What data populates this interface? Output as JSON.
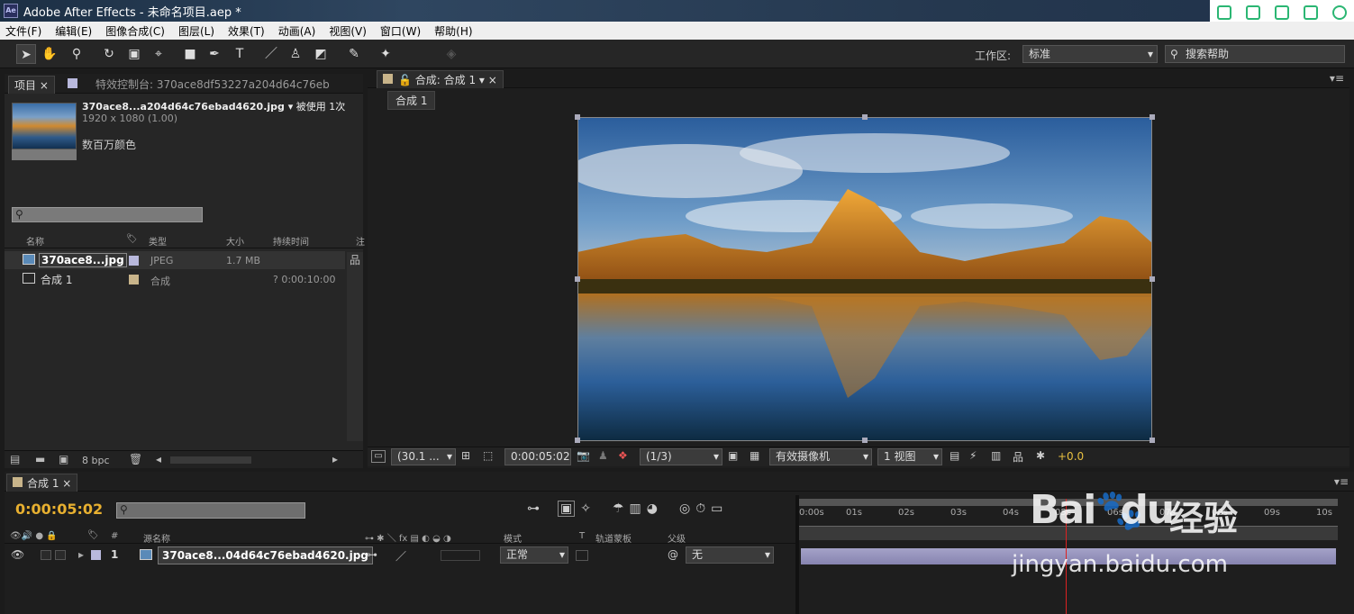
{
  "window": {
    "title": "Adobe After Effects - 未命名项目.aep *",
    "app_icon": "Ae"
  },
  "menu": [
    "文件(F)",
    "编辑(E)",
    "图像合成(C)",
    "图层(L)",
    "效果(T)",
    "动画(A)",
    "视图(V)",
    "窗口(W)",
    "帮助(H)"
  ],
  "toolbar": {
    "workspace_label": "工作区:",
    "workspace_value": "标准",
    "search_help": "搜索帮助"
  },
  "project_panel": {
    "tab_project": "项目",
    "tab_effects": "特效控制台: 370ace8df53227a204d64c76eb",
    "file_name": "370ace8...a204d64c76ebad4620.jpg",
    "usage": "▾ 被使用 1次",
    "dimensions": "1920 x 1080 (1.00)",
    "colors": "数百万颜色",
    "columns": [
      "名称",
      "类型",
      "大小",
      "持续时间",
      "注"
    ],
    "items": [
      {
        "name": "370ace8...jpg",
        "type": "JPEG",
        "size": "1.7 MB",
        "duration": "",
        "color": "#b8b8dc",
        "icon": "image-icon"
      },
      {
        "name": "合成 1",
        "type": "合成",
        "size": "",
        "duration": "? 0:00:10:00",
        "color": "#c8b48a",
        "icon": "composition-icon"
      }
    ],
    "bpc": "8 bpc"
  },
  "comp_panel": {
    "tab_label": "合成: 合成 1",
    "breadcrumb": "合成 1",
    "zoom": "(30.1 ...",
    "timecode": "0:00:05:02",
    "resolution": "(1/3)",
    "camera": "有效摄像机",
    "views": "1 视图",
    "exposure": "+0.0"
  },
  "timeline": {
    "tab_label": "合成 1",
    "timecode": "0:00:05:02",
    "col_headers": [
      "#",
      "源名称",
      "模式",
      "T",
      "轨道蒙板",
      "父级"
    ],
    "layer": {
      "index": "1",
      "name": "370ace8...04d64c76ebad4620.jpg",
      "mode": "正常",
      "parent": "无",
      "color": "#b8b8dc"
    },
    "ruler": [
      "0:00s",
      "01s",
      "02s",
      "03s",
      "04s",
      "05s",
      "06s",
      "07s",
      "08s",
      "09s",
      "10s"
    ],
    "current_time_fraction": 0.51
  },
  "watermark": {
    "brand": "Bai",
    "brand2": "du",
    "product": "经验",
    "url": "jingyan.baidu.com"
  }
}
